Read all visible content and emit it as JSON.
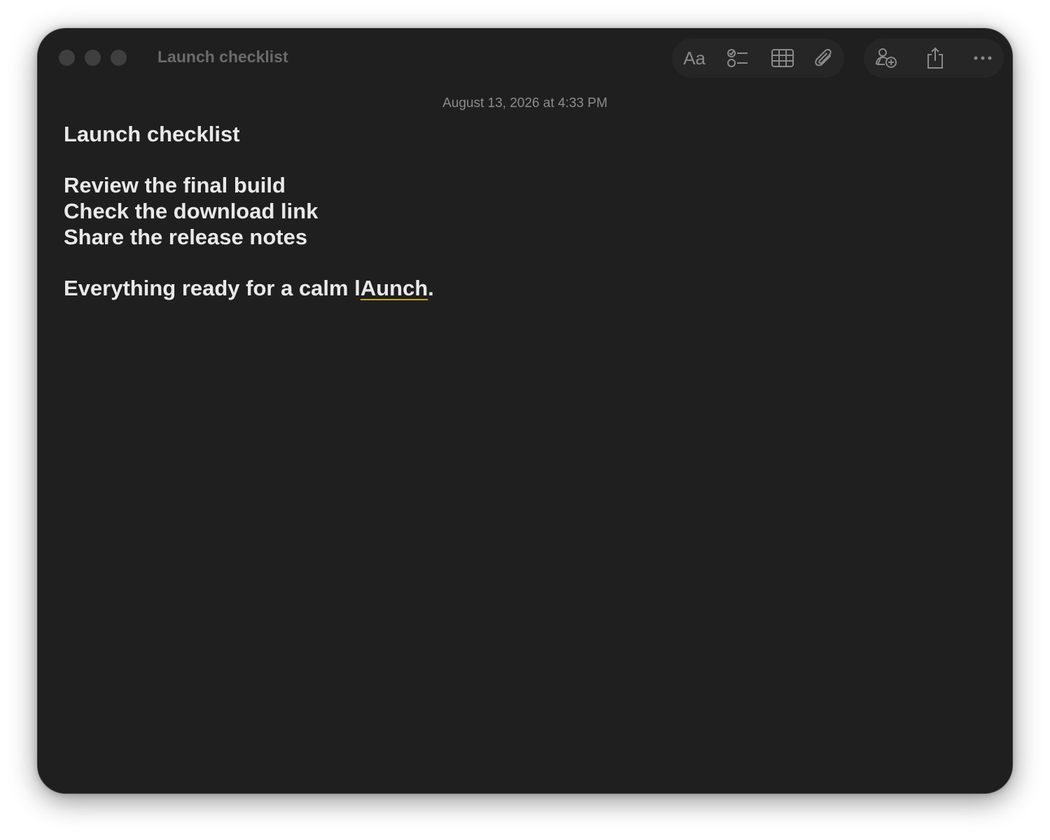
{
  "window": {
    "title": "Launch checklist"
  },
  "toolbar": {
    "format_label": "Aa",
    "icons": [
      "checklist-icon",
      "table-icon",
      "attachment-icon",
      "collaborate-icon",
      "share-icon",
      "more-icon"
    ]
  },
  "note": {
    "timestamp": "August 13, 2026 at 4:33 PM",
    "title": "Launch checklist",
    "items": [
      "Review the final build",
      "Check the download link",
      "Share the release notes"
    ],
    "closing_prefix": "Everything ready for a calm l",
    "closing_misspelled": "Aunch",
    "closing_suffix": "."
  },
  "colors": {
    "window_bg": "#1f1f1f",
    "text": "#e9e9e9",
    "muted": "#8c8c8c",
    "spell_underline": "#c9a227"
  }
}
